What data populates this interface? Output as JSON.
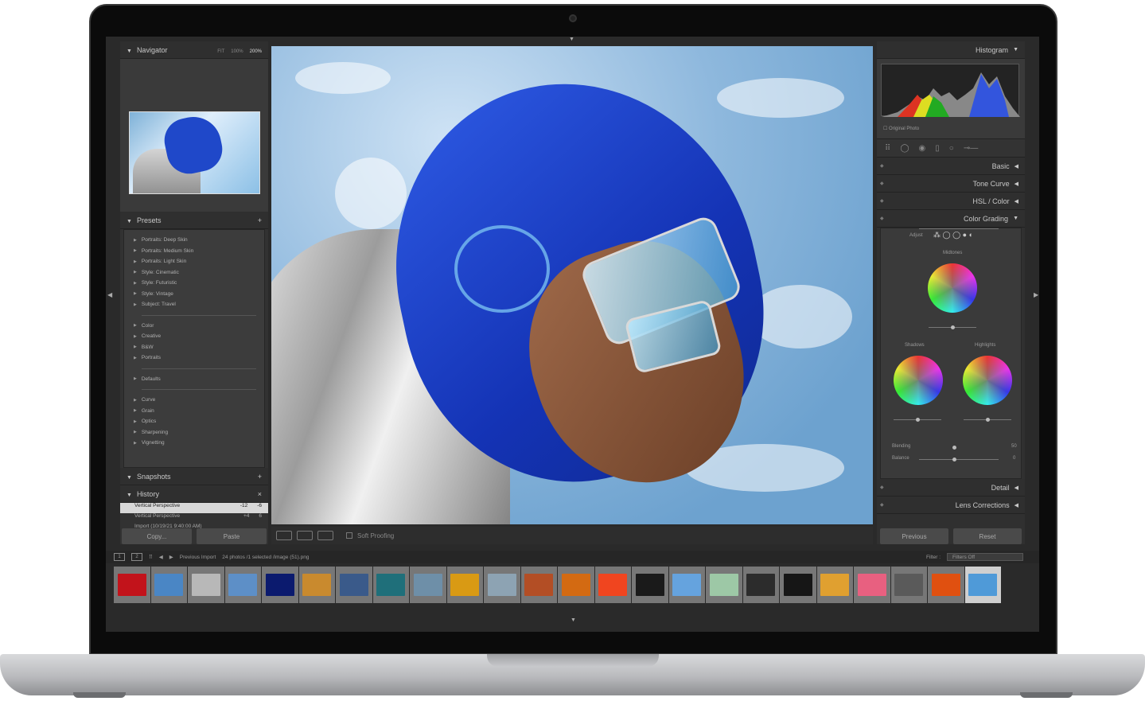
{
  "navigator": {
    "title": "Navigator",
    "zoom": [
      "FIT",
      "100%",
      "200%"
    ]
  },
  "presets": {
    "title": "Presets",
    "group1": [
      "Portraits: Deep Skin",
      "Portraits: Medium Skin",
      "Portraits: Light Skin",
      "Style: Cinematic",
      "Style: Futuristic",
      "Style: Vintage",
      "Subject: Travel"
    ],
    "group2": [
      "Color",
      "Creative",
      "B&W",
      "Portraits"
    ],
    "group3": [
      "Defaults"
    ],
    "group4": [
      "Curve",
      "Grain",
      "Optics",
      "Sharpening",
      "Vignetting"
    ]
  },
  "snapshots": {
    "title": "Snapshots"
  },
  "history": {
    "title": "History",
    "items": [
      {
        "label": "Vertical Perspective",
        "a": "-12",
        "b": "-6"
      },
      {
        "label": "Vertical Perspective",
        "a": "+4",
        "b": "6"
      },
      {
        "label": "Import (10/19/21 9:40:00 AM)",
        "a": "",
        "b": ""
      }
    ]
  },
  "left_buttons": {
    "copy": "Copy...",
    "paste": "Paste"
  },
  "toolbar": {
    "soft_proofing": "Soft Proofing"
  },
  "right_panel": {
    "histogram": "Histogram",
    "original_photo": "Original Photo",
    "sections": [
      "Basic",
      "Tone Curve",
      "HSL / Color",
      "Color Grading",
      "Detail",
      "Lens Corrections"
    ],
    "color_grading": {
      "adjust": "Adjust",
      "midtones": "Midtones",
      "shadows": "Shadows",
      "highlights": "Highlights",
      "blending": "Blending",
      "blending_value": "50",
      "balance": "Balance",
      "balance_value": "0"
    },
    "previous": "Previous",
    "reset": "Reset"
  },
  "filmstrip": {
    "view1": "1",
    "view2": "2",
    "source": "Previous Import",
    "info": "24 photos /1 selected /image (51).png",
    "filter_label": "Filter :",
    "filter_value": "Filters Off",
    "thumb_colors": [
      "#c2131b",
      "#4a86c5",
      "#b8b8b8",
      "#5d8fc7",
      "#0b1a6e",
      "#c98a2e",
      "#3a5a8a",
      "#1f6f7a",
      "#6e8fa8",
      "#d99a14",
      "#8da3b3",
      "#b34e25",
      "#d36a12",
      "#f0451f",
      "#1a1a1a",
      "#65a3de",
      "#9dc8a6",
      "#2c2c2c",
      "#161616",
      "#e0a030",
      "#e86080",
      "#5a5a5a",
      "#e05010",
      "#4f9ad8"
    ]
  },
  "colors": {
    "accent_blue": "#1f48c9"
  }
}
